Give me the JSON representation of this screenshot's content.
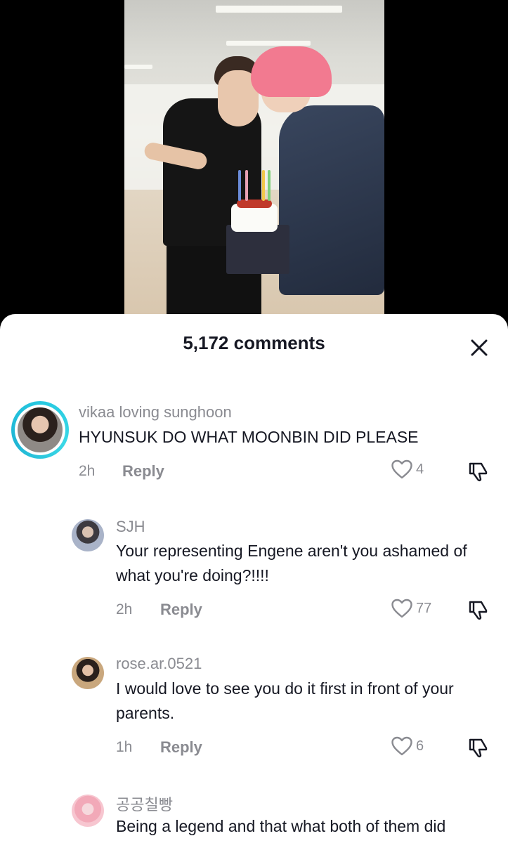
{
  "sheet": {
    "title": "5,172 comments"
  },
  "comments": [
    {
      "username": "vikaa loving sunghoon",
      "text": "HYUNSUK DO WHAT MOONBIN DID PLEASE",
      "time": "2h",
      "reply_label": "Reply",
      "likes": "4"
    },
    {
      "username": "SJH",
      "text": "Your representing Engene aren't you ashamed of what you're doing?!!!!",
      "time": "2h",
      "reply_label": "Reply",
      "likes": "77"
    },
    {
      "username": "rose.ar.0521",
      "text": "I would love to see you do it first in front of your parents.",
      "time": "1h",
      "reply_label": "Reply",
      "likes": "6"
    },
    {
      "username": "공공칠빵",
      "text": "Being a legend and that what both of them did"
    }
  ],
  "colors": {
    "story_ring": "#25c8e0",
    "secondary_text": "#8a8b91",
    "primary_text": "#161823"
  },
  "icons": {
    "close": "close-icon",
    "like": "heart-outline-icon",
    "dislike": "thumbs-down-icon"
  }
}
